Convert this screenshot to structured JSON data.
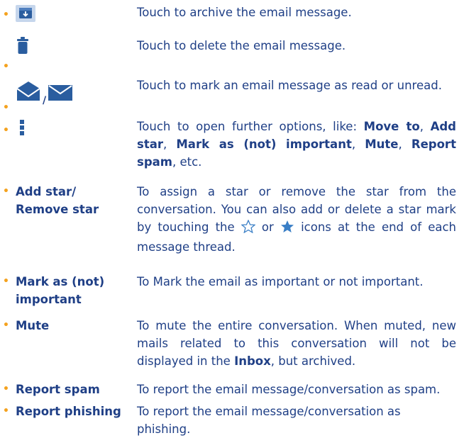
{
  "rows": [
    {
      "id": "archive",
      "icon": "archive-icon",
      "description": "Touch to archive the email message."
    },
    {
      "id": "delete",
      "icon": "trash-icon",
      "description": "Touch to delete the email message."
    },
    {
      "id": "read_unread",
      "icon": "open-envelope-icon / closed-envelope-icon",
      "separator": "/",
      "description": "Touch to mark an email message as read or unread."
    },
    {
      "id": "more",
      "icon": "more-options-icon",
      "description_parts": [
        "Touch to open further options, like: ",
        "Move to",
        ", ",
        "Add star",
        ", ",
        "Mark as (not) important",
        ", ",
        "Mute",
        ", ",
        "Report spam",
        ", etc."
      ]
    },
    {
      "id": "add_star",
      "term_line1": "Add star/",
      "term_line2": "Remove star",
      "description_parts": [
        "To assign a star or remove the star from the conversation. You can also add or delete a star mark by touching the ",
        " or ",
        " icons at the end of each message thread."
      ]
    },
    {
      "id": "important",
      "term_line1": "Mark as (not)",
      "term_line2": "important",
      "description": "To Mark the email as important or not important."
    },
    {
      "id": "mute",
      "term": "Mute",
      "description_parts": [
        "To mute the entire conversation. When muted, new mails related to this conversation will not be displayed in the ",
        "Inbox",
        ", but archived."
      ]
    },
    {
      "id": "spam",
      "term": "Report spam",
      "description": "To report the email message/conversation as spam."
    },
    {
      "id": "phishing",
      "term": "Report phishing",
      "description": "To report the email message/conversation as phishing."
    }
  ],
  "bullet": "•",
  "colors": {
    "text": "#1f3f86",
    "bullet": "#f4a21f",
    "icon": "#2a5d9f",
    "star": "#3a7fc6"
  }
}
